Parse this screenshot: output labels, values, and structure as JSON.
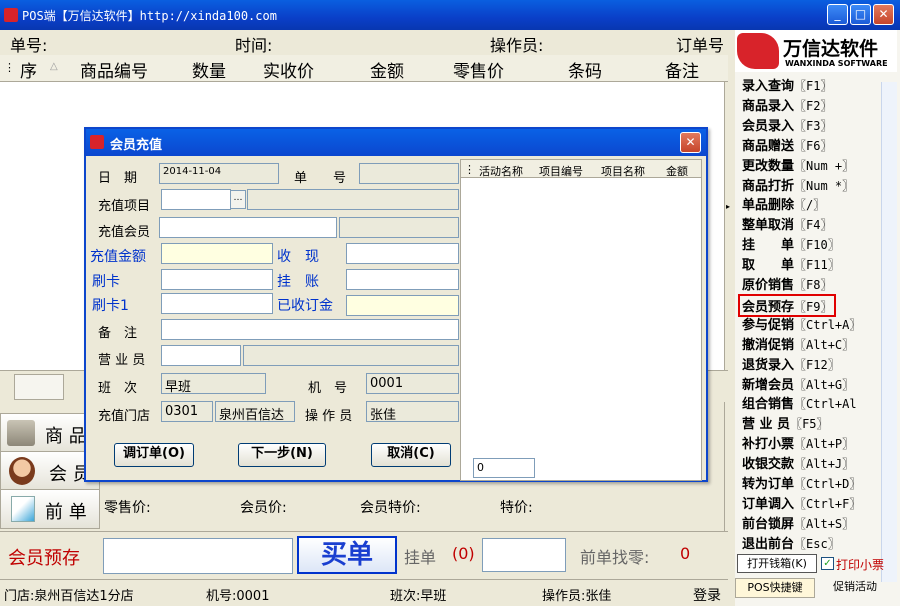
{
  "window": {
    "title": "POS端【万信达软件】http://xinda100.com"
  },
  "info": {
    "order_no": "单号:",
    "time": "时间:",
    "operator": "操作员:",
    "order_ref": "订单号"
  },
  "grid": {
    "columns": [
      "序",
      "商品编号",
      "数量",
      "实收价",
      "金额",
      "零售价",
      "条码",
      "备注"
    ]
  },
  "logo": {
    "name": "万信达软件",
    "sub": "WANXINDA SOFTWARE"
  },
  "menu": [
    {
      "label": "录入查询",
      "key": "〖F1〗"
    },
    {
      "label": "商品录入",
      "key": "〖F2〗"
    },
    {
      "label": "会员录入",
      "key": "〖F3〗"
    },
    {
      "label": "商品赠送",
      "key": "〖F6〗"
    },
    {
      "label": "更改数量",
      "key": "〖Num +〗"
    },
    {
      "label": "商品打折",
      "key": "〖Num *〗"
    },
    {
      "label": "单品删除",
      "key": "〖/〗"
    },
    {
      "label": "整单取消",
      "key": "〖F4〗"
    },
    {
      "label": "挂　　单",
      "key": "〖F10〗"
    },
    {
      "label": "取　　单",
      "key": "〖F11〗"
    },
    {
      "label": "原价销售",
      "key": "〖F8〗"
    },
    {
      "label": "会员预存",
      "key": "〖F9〗"
    },
    {
      "label": "参与促销",
      "key": "〖Ctrl+A〗"
    },
    {
      "label": "撤消促销",
      "key": "〖Alt+C〗"
    },
    {
      "label": "退货录入",
      "key": "〖F12〗"
    },
    {
      "label": "新增会员",
      "key": "〖Alt+G〗"
    },
    {
      "label": "组合销售",
      "key": "〖Ctrl+Al"
    },
    {
      "label": "营 业 员",
      "key": "〖F5〗"
    },
    {
      "label": "补打小票",
      "key": "〖Alt+P〗"
    },
    {
      "label": "收银交款",
      "key": "〖Alt+J〗"
    },
    {
      "label": "转为订单",
      "key": "〖Ctrl+D〗"
    },
    {
      "label": "订单调入",
      "key": "〖Ctrl+F〗"
    },
    {
      "label": "前台锁屏",
      "key": "〖Alt+S〗"
    },
    {
      "label": "退出前台",
      "key": "〖Esc〗"
    }
  ],
  "right_bottom": {
    "open_drawer": "打开钱箱(K)",
    "print_receipt": "打印小票",
    "tab_shortcuts": "POS快捷键",
    "tab_promo": "促销活动"
  },
  "dialog": {
    "title": "会员充值",
    "date_label": "日　期",
    "date_value": "2014-11-04",
    "no_label": "单　　号",
    "item_label": "充值项目",
    "member_label": "充值会员",
    "amount_label": "充值金额",
    "cash_label": "收　现",
    "card_label": "刷卡",
    "credit_label": "挂　账",
    "card1_label": "刷卡1",
    "received_label": "已收订金",
    "remark_label": "备　注",
    "sales_label": "营 业 员",
    "shift_label": "班　次",
    "shift_value": "早班",
    "machine_label": "机　号",
    "machine_value": "0001",
    "store_label": "充值门店",
    "store_code": "0301",
    "store_name": "泉州百信达",
    "operator_label": "操 作 员",
    "operator_value": "张佳",
    "btn_order": "调订单(O)",
    "btn_next": "下一步(N)",
    "btn_cancel": "取消(C)",
    "promo_columns": [
      "活动名称",
      "项目编号",
      "项目名称",
      "金额"
    ],
    "promo_total": "0"
  },
  "bottom": {
    "tab_goods": "商 品",
    "tab_member": "会 员",
    "tab_prev": "前 单",
    "retail_price": "零售价:",
    "member_price": "会员价:",
    "member_special": "会员特价:",
    "special_price": "特价:",
    "mode_label": "会员预存",
    "buy_button": "买单",
    "hang_label": "挂单",
    "hang_count": "(0)",
    "prev_change": "前单找零:",
    "prev_change_value": "0"
  },
  "status": {
    "store": "门店:泉州百信达1分店",
    "machine": "机号:0001",
    "shift": "班次:早班",
    "operator": "操作员:张佳",
    "login": "登录"
  },
  "colors": {
    "title_blue": "#0b47cf",
    "highlight_red": "#e00000",
    "label_blue": "#0033cc"
  }
}
